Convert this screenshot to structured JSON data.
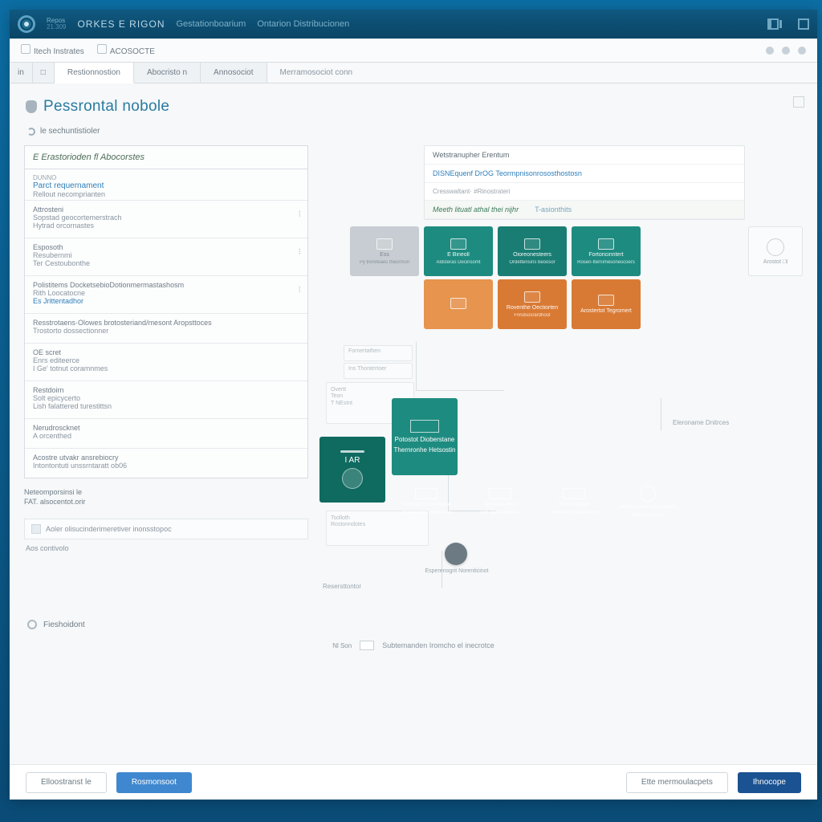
{
  "titlebar": {
    "logo_line1": "Repos",
    "logo_line2": "21.309",
    "app_name": "ORKES E RIGON",
    "menu1": "Gestationboarium",
    "menu2": "Ontarion Distribucionen"
  },
  "subheader": {
    "item1": "Itech Instrates",
    "item2": "ACOSOCTE"
  },
  "tabs": {
    "t_small1": "in",
    "t_small2": "□",
    "t1": "Restionnostion",
    "t2": "Abocristo n",
    "t3": "Annosociot",
    "ghost": "Merramosociot conn"
  },
  "page": {
    "title": "Pessrontal nobole",
    "subtitle": "le sechuntistioler"
  },
  "left": {
    "header": "E Erastorioden fl Abocorstes",
    "group_lbl": "DUNNO",
    "group_link": "Parct requernament",
    "group_desc": "Rellout necomprianten",
    "blocks": [
      {
        "title": "Attrosteni",
        "line1": "Sopstad geocortemerstrach",
        "line2": "Hytrad orcornastes"
      },
      {
        "title": "Esposoth",
        "line1": "Resubernmi",
        "line2": "Ter Cestoubonthe"
      },
      {
        "title": "Polistitems DocketsebioDotionmermastashosm",
        "line1": "Rith Loocatocne",
        "link": "Es Jrittentadhor"
      },
      {
        "title": "Resstrotaens·Olowes brotosteriand/mesont Aropsttoces",
        "line1": "Trostorto dossectionner"
      },
      {
        "title": "OE scret",
        "line1": "Enrs editeerce",
        "line2": "I Ge' totnut coramnmes"
      },
      {
        "title": "Restdoirn",
        "line1": "Solt epicycerto",
        "line2": "Lish falattered turestittsn"
      },
      {
        "title": "Nerudroscknet",
        "line1": "A orcenthed"
      },
      {
        "title": "Acostre utvakr ansrebiocry",
        "line1": "Intontontuti unssrntaratt ob06"
      }
    ],
    "extra_t": "Neteomporsinsi le",
    "extra_v": "FAT. alsocentot.orir",
    "note": "Aoler olisucinderimeretiver inonsstopoc",
    "foot": "Aos contivolo"
  },
  "hcard": {
    "title": "Wetstranupher Erentum",
    "link": "DISNEquenf DrOG Teormpnisonrososthostosn",
    "link2": "Cresswaltant· #Rinostrateri",
    "final1": "Meeth lituatl athal thei nijhr",
    "final2": "T-asionthits"
  },
  "tiles_top": [
    {
      "cls": "muted",
      "t1": "Ess",
      "t2": "Py trenrleaes theormon"
    },
    {
      "cls": "teal",
      "t1": "E Bineoll",
      "t2": "Aldsteras Decinsomt"
    },
    {
      "cls": "teal2",
      "t1": "Oioreonesteers",
      "t2": "Ordettensins beoosor"
    },
    {
      "cls": "teal",
      "t1": "Fortoncinntert",
      "t2": "Rosen-Iternimesonescoers"
    }
  ],
  "tiles_top2": [
    {
      "cls": "orange2",
      "t1": "",
      "t2": ""
    },
    {
      "cls": "orange",
      "t1": "Roventhe Oectiorten",
      "t2": "Frindsosrardhoot"
    },
    {
      "cls": "orange",
      "t1": "Arostertot Tegromert",
      "t2": ""
    }
  ],
  "sidecard": {
    "t": "Arostot □t"
  },
  "ghosts": {
    "g1": "Fornertathen",
    "g2": "Ins Thontertoer",
    "g3a": "Overtt",
    "g3b": "Teon",
    "g3c": "T NEstnt",
    "g4a": "Tsolloth",
    "g4b": "Rostonndotes"
  },
  "bigtiles": {
    "left": "I AR",
    "right_t1": "Potostot Dioberstane",
    "right_t2": "Thernronhe Hetsostin"
  },
  "mid": [
    {
      "cls": "tealL",
      "t1": "Potostot Dioberstane",
      "t2": "Thernronhe Hetsostin"
    },
    {
      "cls": "tealD",
      "t1": "Ditrondesttrin",
      "t2": "sint ige Astertmor"
    },
    {
      "cls": "tealD",
      "t1": "Noronotadoot",
      "t2": "Vechrinit oderctorent"
    },
    {
      "cls": "tealE",
      "t1": "oxyret peoter arsoracery",
      "t2": "Retmeon Lieu"
    }
  ],
  "circle_label": "Esperenogrit Norenticinot",
  "dist_label": "Eleroname Dnitrces",
  "conn_foot": "Resersttontor",
  "section_toggle": "Fieshoidont",
  "legend": {
    "lbl_small": "Nl Son",
    "lbl_main": "Subtemanden Iromcho el inecrotce"
  },
  "footer": {
    "b1": "Elloostranst le",
    "b2": "Rosmonsoot",
    "b3": "Ette mermoulacpets",
    "b4": "Ihnocope"
  }
}
